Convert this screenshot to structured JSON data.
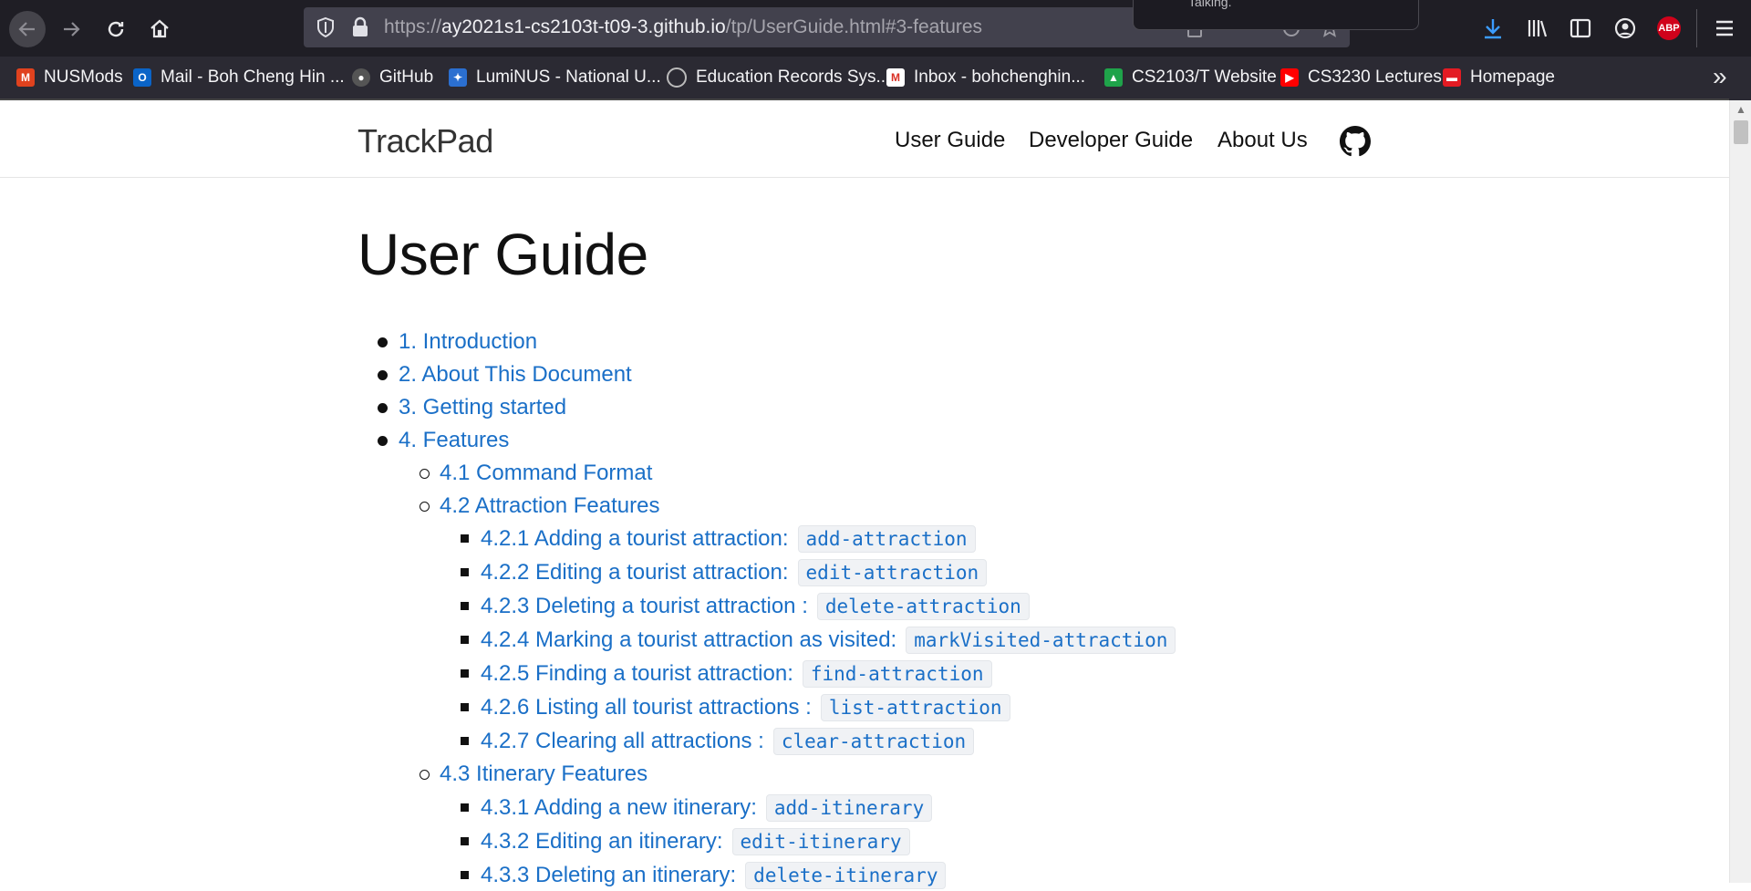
{
  "browser": {
    "url_prefix": "https://",
    "url_host": "ay2021s1-cs2103t-t09-3.github.io",
    "url_path": "/tp/UserGuide.html#3-features",
    "popup_text": "Talking.",
    "abp_label": "ABP",
    "bookmarks": [
      {
        "label": "NUSMods",
        "icon": "nusmods-icon",
        "color": "#e0421e"
      },
      {
        "label": "Mail - Boh Cheng Hin ...",
        "icon": "outlook-icon",
        "color": "#0a64c8"
      },
      {
        "label": "GitHub",
        "icon": "github-icon",
        "color": "#333333"
      },
      {
        "label": "LumiNUS - National U...",
        "icon": "luminus-icon",
        "color": "#2b6fd0"
      },
      {
        "label": "Education Records Sys...",
        "icon": "globe-icon",
        "color": "#8a8a8a"
      },
      {
        "label": "Inbox - bohchenghin...",
        "icon": "gmail-icon",
        "color": "#d93025"
      },
      {
        "label": "CS2103/T Website",
        "icon": "graduation-cap-icon",
        "color": "#1fa34a"
      },
      {
        "label": "CS3230 Lectures",
        "icon": "youtube-icon",
        "color": "#ff0000"
      },
      {
        "label": "Homepage",
        "icon": "homepage-icon",
        "color": "#e31b23"
      }
    ]
  },
  "site": {
    "brand": "TrackPad",
    "nav": [
      "User Guide",
      "Developer Guide",
      "About Us"
    ]
  },
  "page": {
    "title": "User Guide",
    "toc": [
      {
        "level": 1,
        "text": "1. Introduction"
      },
      {
        "level": 1,
        "text": "2. About This Document"
      },
      {
        "level": 1,
        "text": "3. Getting started"
      },
      {
        "level": 1,
        "text": "4. Features"
      },
      {
        "level": 2,
        "text": "4.1 Command Format"
      },
      {
        "level": 2,
        "text": "4.2 Attraction Features"
      },
      {
        "level": 3,
        "text": "4.2.1 Adding a tourist attraction:",
        "code": "add-attraction"
      },
      {
        "level": 3,
        "text": "4.2.2 Editing a tourist attraction:",
        "code": "edit-attraction"
      },
      {
        "level": 3,
        "text": "4.2.3 Deleting a tourist attraction :",
        "code": "delete-attraction"
      },
      {
        "level": 3,
        "text": "4.2.4 Marking a tourist attraction as visited:",
        "code": "markVisited-attraction"
      },
      {
        "level": 3,
        "text": "4.2.5 Finding a tourist attraction:",
        "code": "find-attraction"
      },
      {
        "level": 3,
        "text": "4.2.6 Listing all tourist attractions :",
        "code": "list-attraction"
      },
      {
        "level": 3,
        "text": "4.2.7 Clearing all attractions :",
        "code": "clear-attraction"
      },
      {
        "level": 2,
        "text": "4.3 Itinerary Features"
      },
      {
        "level": 3,
        "text": "4.3.1 Adding a new itinerary:",
        "code": "add-itinerary"
      },
      {
        "level": 3,
        "text": "4.3.2 Editing an itinerary:",
        "code": "edit-itinerary"
      },
      {
        "level": 3,
        "text": "4.3.3 Deleting an itinerary:",
        "code": "delete-itinerary"
      }
    ]
  }
}
